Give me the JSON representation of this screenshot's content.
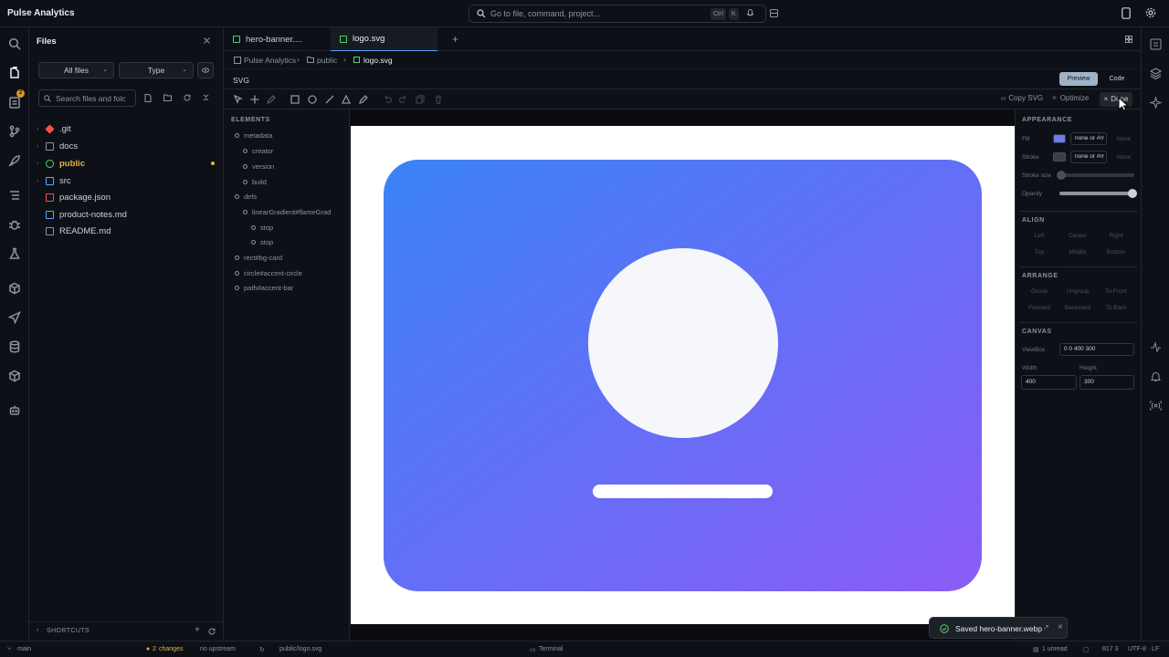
{
  "app": {
    "title": "Pulse Analytics"
  },
  "command": {
    "placeholder": "Go to file, command, project...",
    "kbd_ctrl": "Ctrl",
    "kbd_k": "K"
  },
  "activity": {
    "scm_badge": "2"
  },
  "files": {
    "title": "Files",
    "filter_all": "All files",
    "filter_type": "Type",
    "search_placeholder": "Search files and folc",
    "tree": [
      {
        "label": ".git",
        "color": "#f85149"
      },
      {
        "label": "docs",
        "color": "#8b949e"
      },
      {
        "label": "public",
        "color": "#56d364"
      },
      {
        "label": "src",
        "color": "#58a6ff"
      },
      {
        "label": "package.json",
        "color": "#f85149"
      },
      {
        "label": "product-notes.md",
        "color": "#58a6ff"
      },
      {
        "label": "README.md",
        "color": "#8b949e"
      }
    ],
    "shortcuts": "SHORTCUTS"
  },
  "tabs": [
    {
      "label": "hero-banner...."
    },
    {
      "label": "logo.svg"
    }
  ],
  "breadcrumb": {
    "root": "Pulse Analytics",
    "folder": "public",
    "file": "logo.svg"
  },
  "svgbar": {
    "label": "SVG",
    "preview": "Preview",
    "code": "Code"
  },
  "toolbar": {
    "copy_svg": "Copy SVG",
    "optimize": "Optimize",
    "done": "Done"
  },
  "elements": {
    "title": "ELEMENTS",
    "items": [
      {
        "label": "metadata"
      },
      {
        "label": "creator"
      },
      {
        "label": "version"
      },
      {
        "label": "build"
      },
      {
        "label": "defs"
      },
      {
        "label": "linearGradient#flameGrad"
      },
      {
        "label": "stop"
      },
      {
        "label": "stop"
      },
      {
        "label": "rect#bg-card"
      },
      {
        "label": "circle#accent-circle"
      },
      {
        "label": "path#accent-bar"
      }
    ]
  },
  "canvas": {
    "gradient_start": "#3b82f6",
    "gradient_end": "#8b5cf6",
    "circle_fill": "#f5f7fa",
    "bar_fill": "#ffffff"
  },
  "props": {
    "appearance": "APPEARANCE",
    "fill_label": "Fill",
    "fill_value": "none or #rr",
    "fill_none": "None",
    "fill_color": "#6b7cf0",
    "stroke_label": "Stroke",
    "stroke_value": "none or #rr",
    "stroke_none": "None",
    "stroke_size_label": "Stroke size",
    "opacity_label": "Opacity",
    "align": "ALIGN",
    "align_items": [
      "Left",
      "Center",
      "Right",
      "Top",
      "Middle",
      "Bottom"
    ],
    "arrange": "ARRANGE",
    "arrange_items": [
      "Group",
      "Ungroup",
      "To Front",
      "Forward",
      "Backward",
      "To Back"
    ],
    "canvas": "CANVAS",
    "viewbox_label": "ViewBox",
    "viewbox_value": "0 0 400 300",
    "width_label": "Width",
    "width_value": "400",
    "height_label": "Height",
    "height_value": "300"
  },
  "status": {
    "branch": "main",
    "changes_count": "2",
    "changes_label": "changes",
    "upstream": "no upstream",
    "file": "public/logo.svg",
    "terminal": "Terminal",
    "unread": "1 unread",
    "ln": "817 3",
    "encoding": "UTF-8 · LF"
  },
  "toast": {
    "text": "Saved hero-banner.webp"
  }
}
